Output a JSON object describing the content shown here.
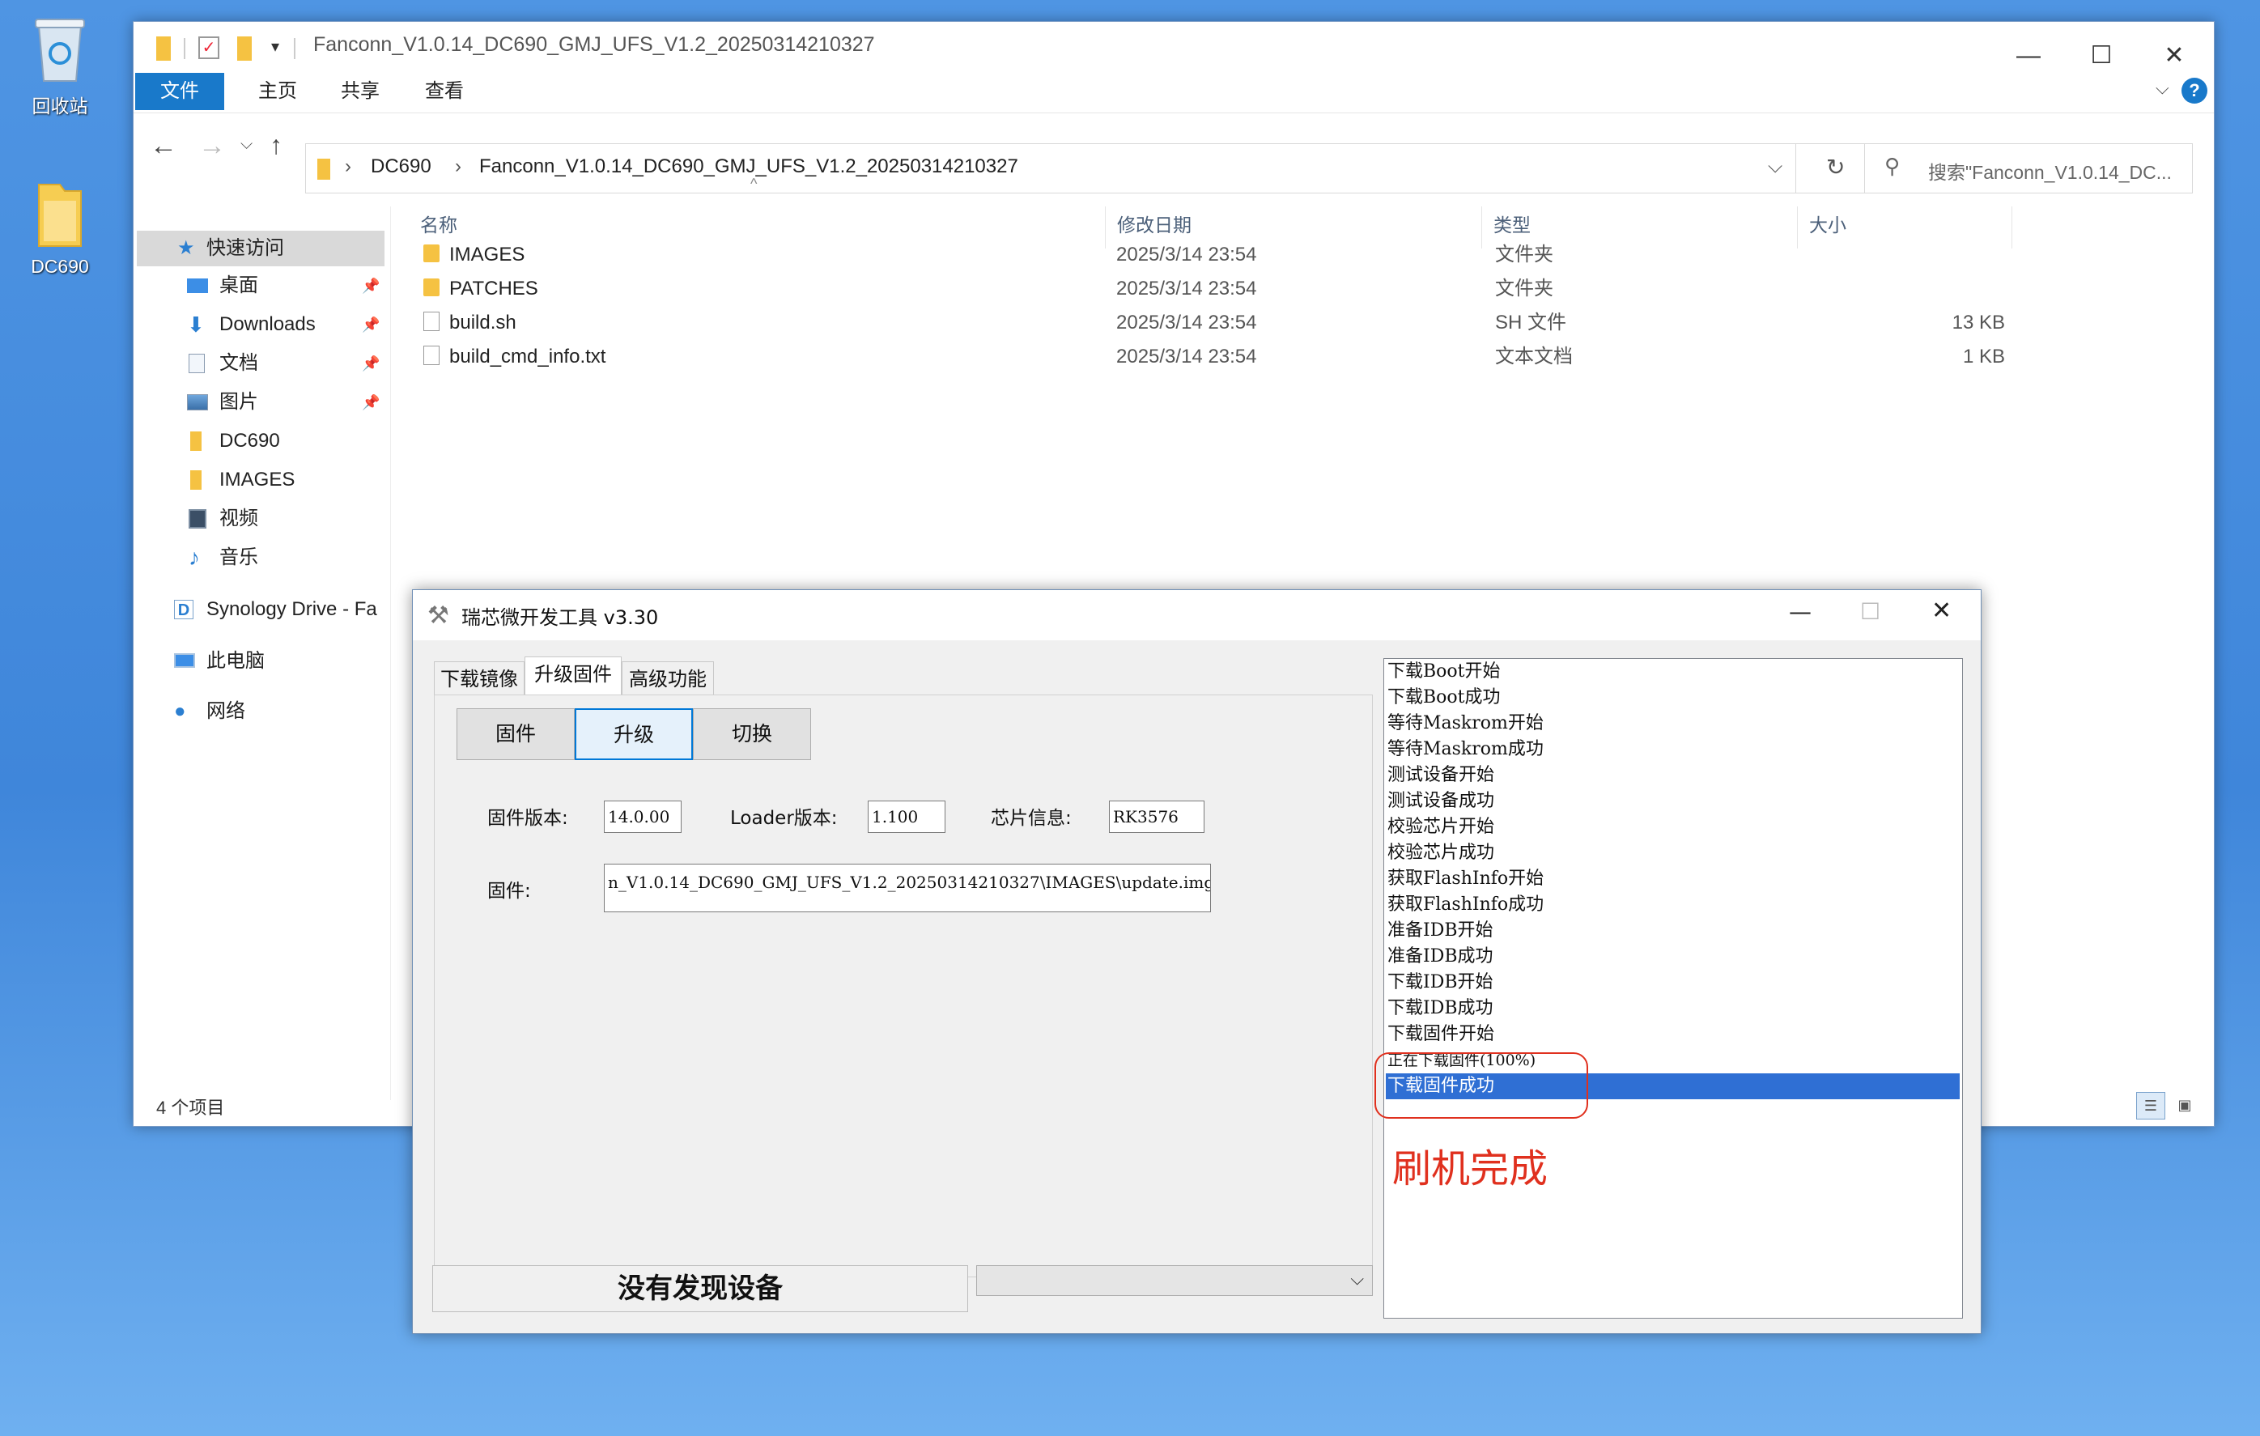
{
  "desktop": {
    "icons": [
      {
        "label": "回收站",
        "icon": "recycle-bin-icon"
      },
      {
        "label": "DC690",
        "icon": "folder-icon"
      }
    ]
  },
  "explorer": {
    "title": "Fanconn_V1.0.14_DC690_GMJ_UFS_V1.2_20250314210327",
    "ribbon_tabs": [
      "文件",
      "主页",
      "共享",
      "查看"
    ],
    "breadcrumb": [
      "DC690",
      "Fanconn_V1.0.14_DC690_GMJ_UFS_V1.2_20250314210327"
    ],
    "search_placeholder": "搜索\"Fanconn_V1.0.14_DC...",
    "nav_items": [
      "快速访问",
      "桌面",
      "Downloads",
      "文档",
      "图片",
      "DC690",
      "IMAGES",
      "视频",
      "音乐",
      "Synology Drive - Fa",
      "此电脑",
      "网络"
    ],
    "columns": [
      "名称",
      "修改日期",
      "类型",
      "大小"
    ],
    "files": [
      {
        "name": "IMAGES",
        "date": "2025/3/14 23:54",
        "type": "文件夹",
        "size": "",
        "kind": "folder"
      },
      {
        "name": "PATCHES",
        "date": "2025/3/14 23:54",
        "type": "文件夹",
        "size": "",
        "kind": "folder"
      },
      {
        "name": "build.sh",
        "date": "2025/3/14 23:54",
        "type": "SH 文件",
        "size": "13 KB",
        "kind": "file"
      },
      {
        "name": "build_cmd_info.txt",
        "date": "2025/3/14 23:54",
        "type": "文本文档",
        "size": "1 KB",
        "kind": "file"
      }
    ],
    "status": "4 个项目",
    "accent": "#1979ca"
  },
  "tool": {
    "title": "瑞芯微开发工具 v3.30",
    "tabs": [
      "下载镜像",
      "升级固件",
      "高级功能"
    ],
    "selected_tab": "升级固件",
    "buttons": [
      "固件",
      "升级",
      "切换"
    ],
    "fw_version_label": "固件版本:",
    "fw_version": "14.0.00",
    "loader_label": "Loader版本:",
    "loader_version": "1.100",
    "chip_label": "芯片信息:",
    "chip": "RK3576",
    "firmware_label": "固件:",
    "firmware_path": "n_V1.0.14_DC690_GMJ_UFS_V1.2_20250314210327\\IMAGES\\update.img",
    "device_status": "没有发现设备",
    "log": [
      "下载Boot开始",
      "下载Boot成功",
      "等待Maskrom开始",
      "等待Maskrom成功",
      "测试设备开始",
      "测试设备成功",
      "校验芯片开始",
      "校验芯片成功",
      "获取FlashInfo开始",
      "获取FlashInfo成功",
      "准备IDB开始",
      "准备IDB成功",
      "下载IDB开始",
      "下载IDB成功",
      "下载固件开始",
      "正在下载固件(100%)",
      "下载固件成功"
    ],
    "highlight_color": "#2f6fd4"
  },
  "annotation": {
    "text": "刷机完成",
    "color": "#e0301e"
  }
}
